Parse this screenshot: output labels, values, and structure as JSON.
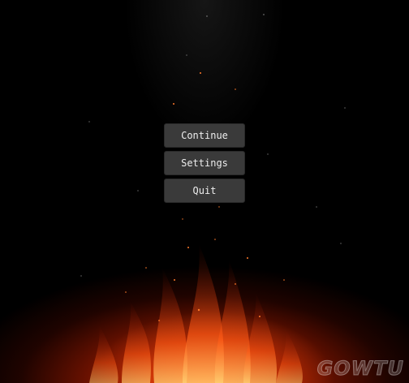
{
  "menu": {
    "continue_label": "Continue",
    "settings_label": "Settings",
    "quit_label": "Quit"
  },
  "watermark": {
    "text": "GOWTU"
  },
  "colors": {
    "button_bg": "#3a3a3a",
    "button_text": "#ededed",
    "fire_core": "#ffbe50",
    "fire_mid": "#ff4610",
    "background": "#000000"
  }
}
